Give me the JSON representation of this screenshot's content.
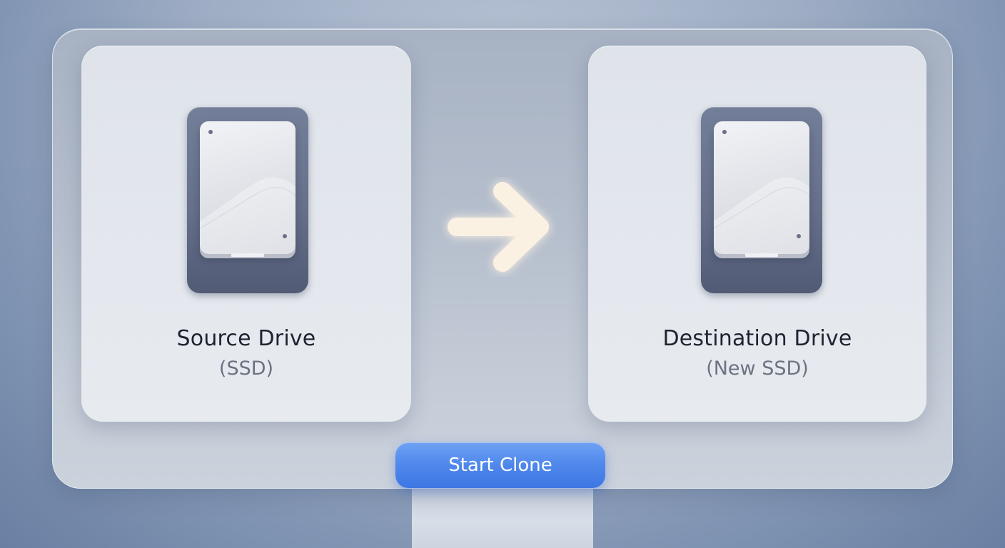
{
  "source": {
    "title": "Source Drive",
    "subtitle": "(SSD)",
    "icon": "drive-icon"
  },
  "destination": {
    "title": "Destination Drive",
    "subtitle": "(New SSD)",
    "icon": "drive-icon"
  },
  "direction_icon": "arrow-right-icon",
  "action": {
    "label": "Start Clone"
  },
  "colors": {
    "accent": "#4f87eb",
    "drive_body": "#66708b",
    "arrow_glow": "#fdf3e4"
  }
}
